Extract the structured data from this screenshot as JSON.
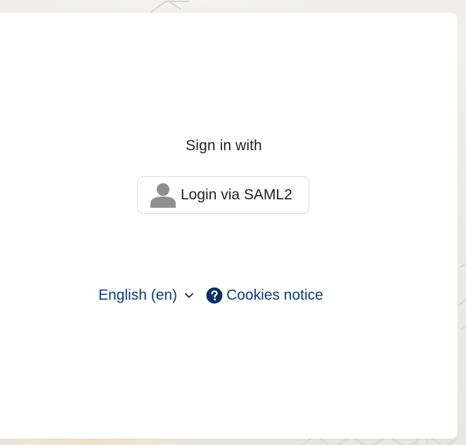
{
  "login": {
    "heading": "Sign in with",
    "identity_provider": {
      "label": "Login via SAML2",
      "icon": "user-silhouette-icon"
    }
  },
  "footer": {
    "language": {
      "selected": "English (en)",
      "icon": "chevron-down-icon"
    },
    "cookies": {
      "label": "Cookies notice",
      "icon": "question-circle-icon"
    }
  },
  "colors": {
    "link": "#0d3b7e",
    "text": "#1d2125",
    "icon_gray": "#8f8f8f",
    "card_background": "#ffffff"
  }
}
